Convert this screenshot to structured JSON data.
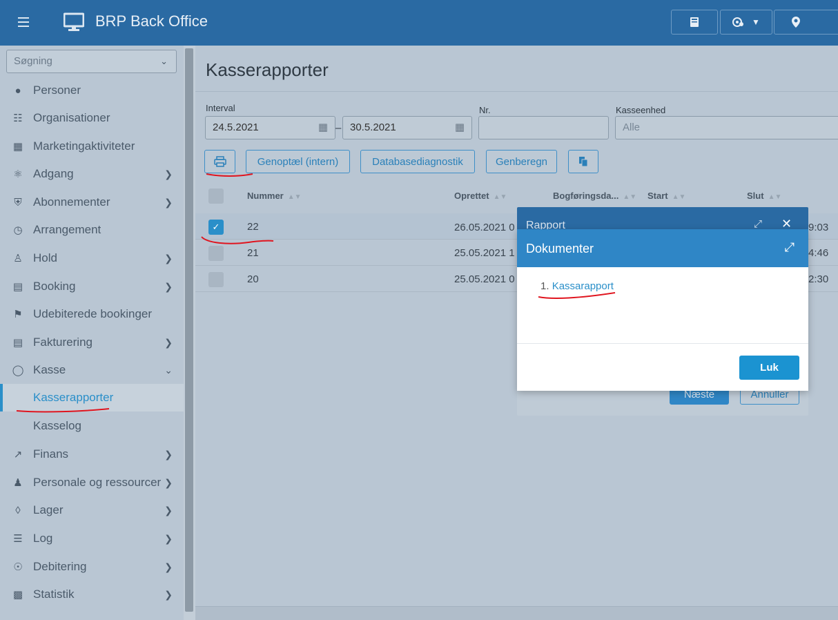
{
  "header": {
    "app_title": "BRP Back Office",
    "menu_icon": "hamburger-icon",
    "app_icon": "monitor-icon",
    "buttons": [
      {
        "icon": "book-icon"
      },
      {
        "icon": "user-settings-icon"
      },
      {
        "icon": "location-pin-icon"
      }
    ]
  },
  "sidebar": {
    "search_placeholder": "Søgning",
    "items": [
      {
        "label": "Personer",
        "icon": "person-icon"
      },
      {
        "label": "Organisationer",
        "icon": "org-chart-icon"
      },
      {
        "label": "Marketingaktiviteter",
        "icon": "calendar-icon"
      },
      {
        "label": "Adgang",
        "icon": "key-icon"
      },
      {
        "label": "Abonnementer",
        "icon": "shield-icon"
      },
      {
        "label": "Arrangement",
        "icon": "calendar-clock-icon"
      },
      {
        "label": "Hold",
        "icon": "group-icon"
      },
      {
        "label": "Booking",
        "icon": "cart-icon"
      },
      {
        "label": "Udebiterede bookinger",
        "icon": "flag-icon"
      },
      {
        "label": "Fakturering",
        "icon": "invoice-icon"
      },
      {
        "label": "Kasse",
        "icon": "coins-icon"
      },
      {
        "label": "Kasserapporter"
      },
      {
        "label": "Kasselog"
      },
      {
        "label": "Finans",
        "icon": "trend-icon"
      },
      {
        "label": "Personale og ressourcer",
        "icon": "staff-icon"
      },
      {
        "label": "Lager",
        "icon": "boxes-icon"
      },
      {
        "label": "Log",
        "icon": "list-icon"
      },
      {
        "label": "Debitering",
        "icon": "debit-icon"
      },
      {
        "label": "Statistik",
        "icon": "bar-chart-icon"
      }
    ]
  },
  "main": {
    "page_title": "Kasserapporter",
    "filters": {
      "interval_label": "Interval",
      "date_from": "24.5.2021",
      "date_to": "30.5.2021",
      "range_sep": "–",
      "nr_label": "Nr.",
      "nr_value": "",
      "kasseenhed_label": "Kasseenhed",
      "kasseenhed_placeholder": "Alle"
    },
    "toolbar": {
      "print_icon": "printer-icon",
      "genoptael": "Genoptæl (intern)",
      "databasediagnostik": "Databasediagnostik",
      "genberegn": "Genberegn",
      "copy_icon": "copy-icon"
    },
    "table": {
      "columns": [
        "Nummer",
        "Oprettet",
        "Bogføringsda...",
        "Start",
        "Slut"
      ],
      "rows": [
        {
          "nummer": "22",
          "oprettet": "26.05.2021 0",
          "slut": "9:03",
          "selected": true
        },
        {
          "nummer": "21",
          "oprettet": "25.05.2021 1",
          "slut": "4:46",
          "selected": false
        },
        {
          "nummer": "20",
          "oprettet": "25.05.2021 0",
          "slut": "2:30",
          "selected": false
        }
      ]
    }
  },
  "dialog_rapport": {
    "title": "Rapport",
    "next_button": "Næste",
    "cancel_button": "Annuller"
  },
  "dialog_dokumenter": {
    "title": "Dokumenter",
    "list_number": "1.",
    "link_label": "Kassarapport",
    "close_button": "Luk"
  },
  "colors": {
    "header_bg": "#2a6aa3",
    "accent": "#2a8fc9",
    "annotation": "#e0141e"
  }
}
